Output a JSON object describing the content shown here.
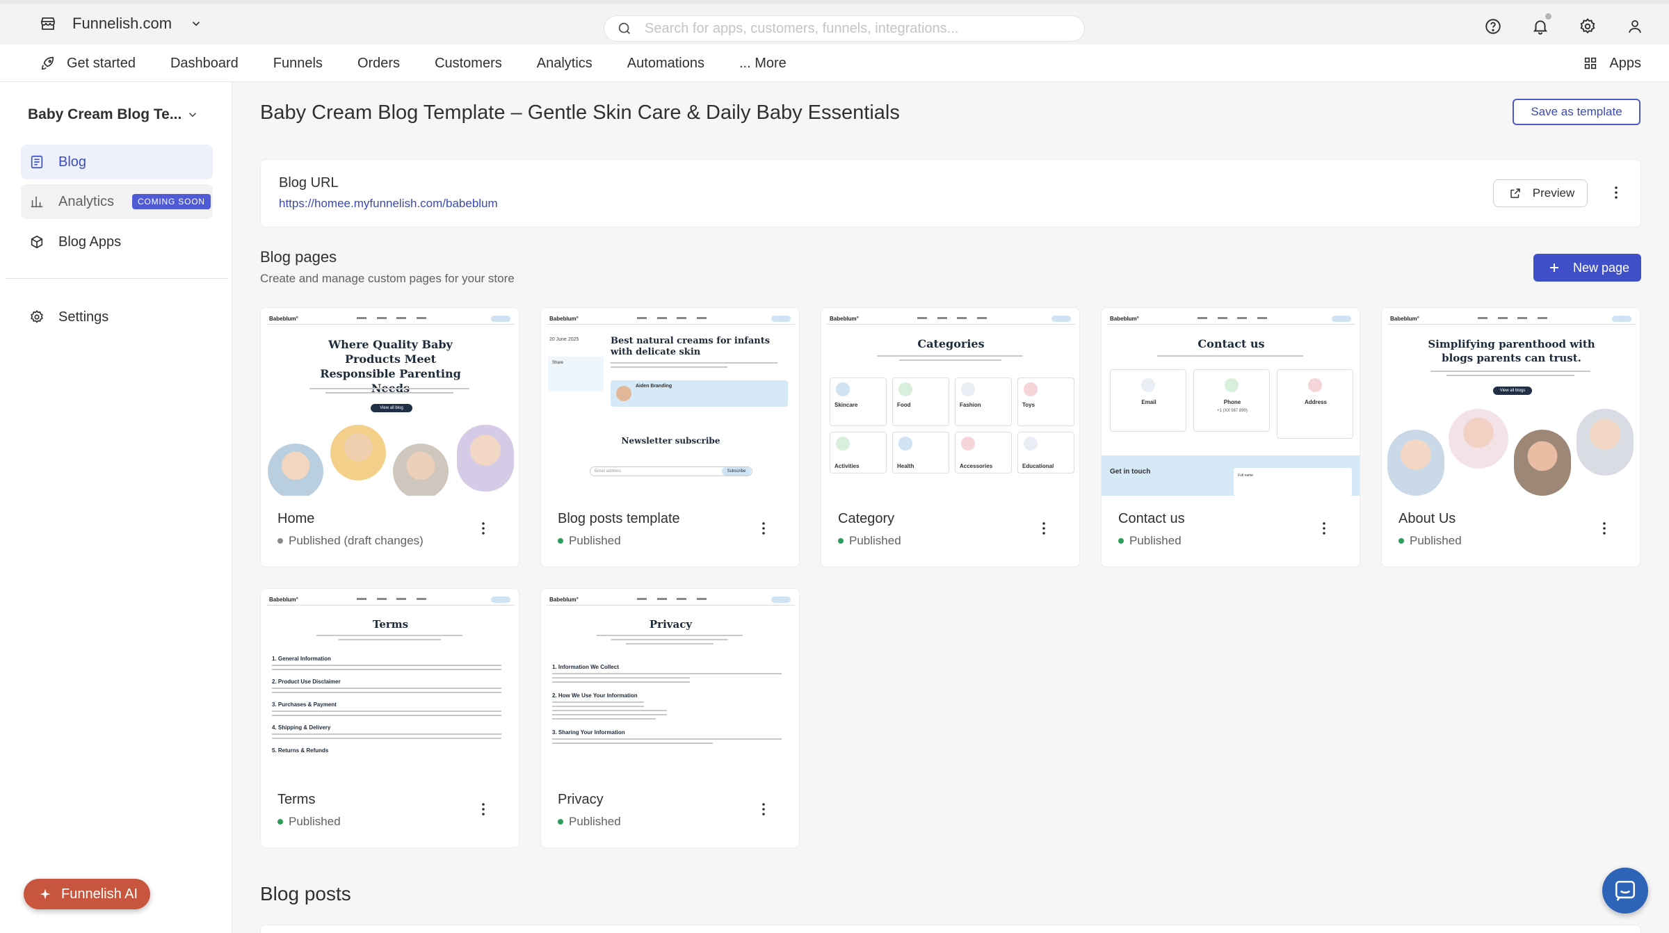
{
  "topbar": {
    "store_name": "Funnelish.com",
    "search_placeholder": "Search for apps, customers, funnels, integrations..."
  },
  "nav": {
    "items": [
      "Get started",
      "Dashboard",
      "Funnels",
      "Orders",
      "Customers",
      "Analytics",
      "Automations",
      "... More"
    ],
    "apps_label": "Apps"
  },
  "sidebar": {
    "blog_name": "Baby Cream Blog Te...",
    "items": [
      {
        "label": "Blog",
        "icon": "blog-icon"
      },
      {
        "label": "Analytics",
        "icon": "bar-chart-icon",
        "badge": "COMING SOON"
      },
      {
        "label": "Blog Apps",
        "icon": "cube-icon"
      }
    ],
    "settings_label": "Settings",
    "ai_button": "Funnelish AI"
  },
  "main": {
    "title": "Baby Cream Blog Template – Gentle Skin Care & Daily Baby Essentials",
    "save_template": "Save as template",
    "blog_url_label": "Blog URL",
    "blog_url": "https://homee.myfunnelish.com/babeblum",
    "preview_label": "Preview",
    "pages_title": "Blog pages",
    "pages_subtitle": "Create and manage custom pages for your store",
    "new_page": "New page",
    "posts_title": "Blog posts"
  },
  "cards": [
    {
      "name": "Home",
      "status": "Published (draft changes)",
      "status_color": "#8a8a8a",
      "thumb_title": "Where Quality Baby Products Meet Responsible Parenting Needs",
      "thumb_button": "View all blog"
    },
    {
      "name": "Blog posts template",
      "status": "Published",
      "status_color": "#2e9d5b",
      "thumb_title": "Best natural creams for infants with delicate skin",
      "thumb_date": "20 June 2025",
      "thumb_author": "Aiden Branding",
      "thumb_share": "Share",
      "thumb_newsletter": "Newsletter subscribe",
      "thumb_email": "Email address",
      "thumb_subscribe": "Subscribe"
    },
    {
      "name": "Category",
      "status": "Published",
      "status_color": "#2e9d5b",
      "thumb_title": "Categories",
      "thumb_categories": [
        "Skincare",
        "Food",
        "Fashion",
        "Toys",
        "Activities",
        "Health",
        "Accessories",
        "Educational"
      ]
    },
    {
      "name": "Contact us",
      "status": "Published",
      "status_color": "#2e9d5b",
      "thumb_title": "Contact us",
      "thumb_contacts": [
        "Email",
        "Phone",
        "Address"
      ],
      "thumb_phone": "+1 (XX 567 890)",
      "thumb_touch": "Get in touch",
      "thumb_fullname": "Full name"
    },
    {
      "name": "About Us",
      "status": "Published",
      "status_color": "#2e9d5b",
      "thumb_title": "Simplifying parenthood with blogs parents can trust.",
      "thumb_button": "View all blogs"
    },
    {
      "name": "Terms",
      "status": "Published",
      "status_color": "#2e9d5b",
      "thumb_title": "Terms",
      "thumb_sections": [
        "1. General Information",
        "2. Product Use Disclaimer",
        "3. Purchases & Payment",
        "4. Shipping & Delivery",
        "5. Returns & Refunds"
      ]
    },
    {
      "name": "Privacy",
      "status": "Published",
      "status_color": "#2e9d5b",
      "thumb_title": "Privacy",
      "thumb_sections": [
        "1. Information We Collect",
        "2. How We Use Your Information",
        "3. Sharing Your Information"
      ]
    }
  ],
  "mini_site": {
    "logo": "Babeblum°"
  },
  "colors": {
    "accent": "#4050c8",
    "ai": "#c8553d",
    "chat": "#2d64b7",
    "published": "#2e9d5b"
  }
}
